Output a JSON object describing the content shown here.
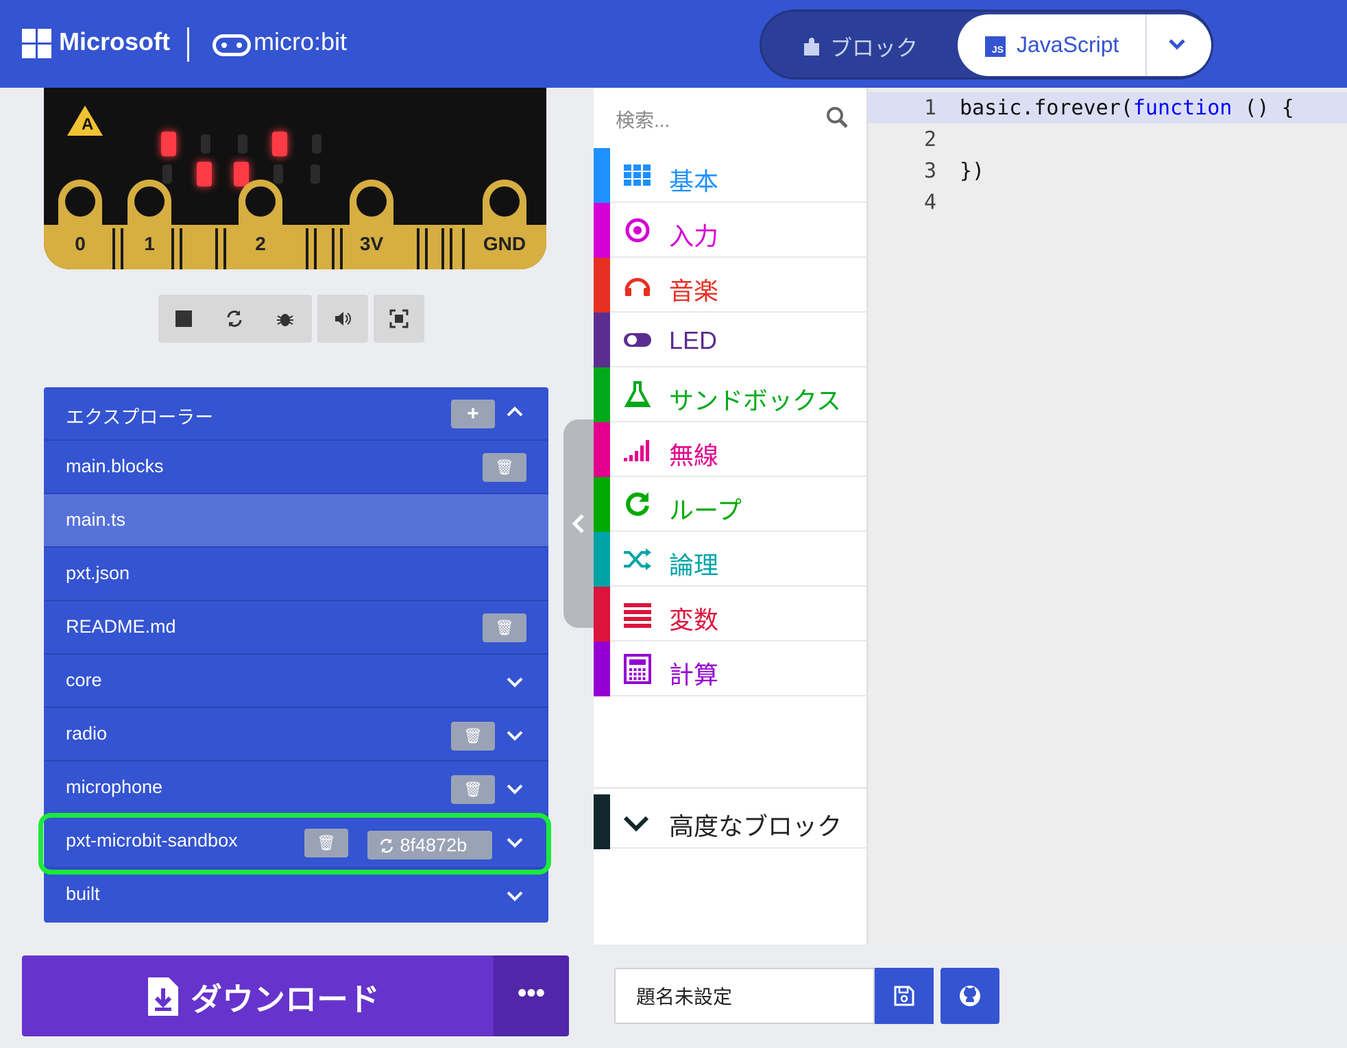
{
  "header": {
    "brand_microsoft": "Microsoft",
    "brand_microbit": "micro:bit",
    "tab_blocks": "ブロック",
    "tab_javascript": "JavaScript",
    "js_badge": "JS"
  },
  "simulator": {
    "button_a": "A",
    "pins": [
      "0",
      "1",
      "2",
      "3V",
      "GND"
    ],
    "led_matrix": [
      [
        0,
        0,
        0,
        0,
        0
      ],
      [
        1,
        0,
        0,
        1,
        0
      ],
      [
        0,
        1,
        1,
        0,
        0
      ]
    ],
    "led_color": "#ff3b46"
  },
  "explorer": {
    "title": "エクスプローラー",
    "files": [
      {
        "name": "main.blocks"
      },
      {
        "name": "main.ts"
      },
      {
        "name": "pxt.json"
      },
      {
        "name": "README.md"
      },
      {
        "name": "core"
      },
      {
        "name": "radio"
      },
      {
        "name": "microphone"
      },
      {
        "name": "pxt-microbit-sandbox",
        "version": "8f4872b"
      },
      {
        "name": "built"
      }
    ]
  },
  "toolbox": {
    "search_placeholder": "検索...",
    "categories": [
      {
        "label": "基本",
        "color": "#1e90ff"
      },
      {
        "label": "入力",
        "color": "#d400d4"
      },
      {
        "label": "音楽",
        "color": "#e63022"
      },
      {
        "label": "LED",
        "color": "#5c2d91"
      },
      {
        "label": "サンドボックス",
        "color": "#00a91a"
      },
      {
        "label": "無線",
        "color": "#e3008c"
      },
      {
        "label": "ループ",
        "color": "#00aa00"
      },
      {
        "label": "論理",
        "color": "#00a4a6"
      },
      {
        "label": "変数",
        "color": "#dc143c"
      },
      {
        "label": "計算",
        "color": "#9400d3"
      }
    ],
    "advanced": "高度なブロック"
  },
  "editor": {
    "lines": [
      {
        "num": "1",
        "pre": "basic.forever(",
        "kw": "function",
        "post": " () {"
      },
      {
        "num": "2",
        "pre": "",
        "kw": "",
        "post": ""
      },
      {
        "num": "3",
        "pre": "})",
        "kw": "",
        "post": ""
      },
      {
        "num": "4",
        "pre": "",
        "kw": "",
        "post": ""
      }
    ]
  },
  "footer": {
    "download_label": "ダウンロード",
    "more_label": "•••",
    "project_name": "題名未設定"
  }
}
